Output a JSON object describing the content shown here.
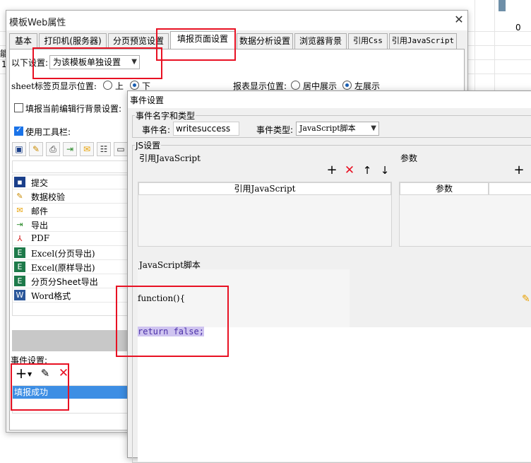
{
  "background_sheet": {
    "top_left_text": "能",
    "row_label": "1",
    "cell_value": "0"
  },
  "window": {
    "title": "模板Web属性",
    "close_glyph": "✕"
  },
  "tabs": [
    {
      "label": "基本"
    },
    {
      "label": "打印机(服务器)"
    },
    {
      "label": "分页预览设置"
    },
    {
      "label": "填报页面设置"
    },
    {
      "label": "数据分析设置"
    },
    {
      "label": "浏览器背景"
    },
    {
      "label": "引用Css"
    },
    {
      "label": "引用JavaScript"
    }
  ],
  "settings": {
    "apply_label": "以下设置:",
    "apply_value": "为该模板单独设置",
    "sheet_tab_position_label": "sheet标签页显示位置:",
    "sheet_tab_options": [
      "上",
      "下"
    ],
    "report_position_label": "报表显示位置:",
    "report_position_options": [
      "居中展示",
      "左展示"
    ],
    "fill_bg_label": "填报当前编辑行背景设置:",
    "use_toolbar_label": "使用工具栏:"
  },
  "toolbar_list": [
    {
      "label": "提交",
      "icon": "save-icon"
    },
    {
      "label": "数据校验",
      "icon": "validate-icon"
    },
    {
      "label": "邮件",
      "icon": "mail-icon"
    },
    {
      "label": "导出",
      "icon": "export-icon"
    },
    {
      "label": "PDF",
      "icon": "pdf-icon"
    },
    {
      "label": "Excel(分页导出)",
      "icon": "excel-icon"
    },
    {
      "label": "Excel(原样导出)",
      "icon": "excel-icon"
    },
    {
      "label": "分页分Sheet导出",
      "icon": "excel-icon"
    },
    {
      "label": "Word格式",
      "icon": "word-icon"
    }
  ],
  "events": {
    "label": "事件设置:",
    "items": [
      "填报成功"
    ]
  },
  "dialog": {
    "title": "事件设置",
    "name_type_group": "事件名字和类型",
    "event_name_label": "事件名:",
    "event_name_value": "writesuccess",
    "event_type_label": "事件类型:",
    "event_type_value": "JavaScript脚本",
    "js_group": "JS设置",
    "ref_js_label": "引用JavaScript",
    "params_label": "参数",
    "ref_js_header": "引用JavaScript",
    "params_header": "参数",
    "script_label": "JavaScript脚本",
    "code_line1": "function(){",
    "code_line2": "return false;"
  },
  "colors": {
    "highlight_red": "#e81123",
    "selection_blue": "#3d8ee4",
    "delete_red": "#e81123"
  }
}
